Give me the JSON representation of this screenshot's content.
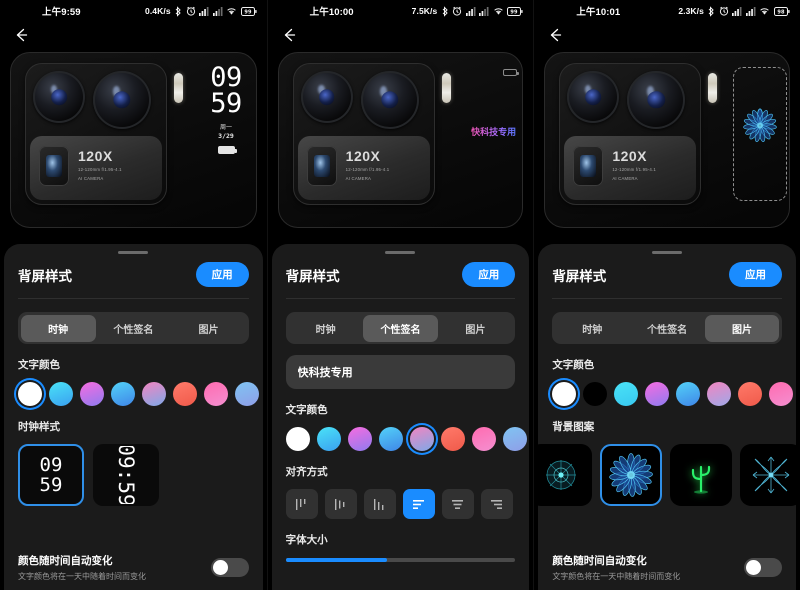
{
  "panels": [
    {
      "statusbar": {
        "time": "上午9:59",
        "netspeed": "0.4K/s",
        "battery": "99"
      },
      "back_label": "back-arrow",
      "preview": {
        "camera": {
          "zoom_label": "120X",
          "spec": "12-120mm f/1.95-4.1",
          "brand": "AI CAMERA"
        },
        "rear_display": {
          "hour": "09",
          "minute": "59",
          "weekday": "周一",
          "date": "3/29"
        }
      },
      "sheet": {
        "title": "背屏样式",
        "apply_label": "应用",
        "tabs": [
          {
            "label": "时钟",
            "active": true
          },
          {
            "label": "个性签名",
            "active": false
          },
          {
            "label": "图片",
            "active": false
          }
        ],
        "text_color_label": "文字颜色",
        "text_colors": [
          {
            "name": "white",
            "css": "#ffffff",
            "selected": true
          },
          {
            "name": "cyan-blue",
            "css": "linear-gradient(160deg,#4ae3f7,#3aa0f0)",
            "selected": false
          },
          {
            "name": "pink-purple",
            "css": "linear-gradient(160deg,#f76ce0,#8f7bf0)",
            "selected": false
          },
          {
            "name": "sky-blue",
            "css": "linear-gradient(160deg,#53d2f8,#3f86e8)",
            "selected": false
          },
          {
            "name": "pink-blue",
            "css": "linear-gradient(160deg,#f285c0,#7fa8e8)",
            "selected": false
          },
          {
            "name": "red-orange",
            "css": "linear-gradient(160deg,#ff7a6a,#f05a4a)",
            "selected": false
          },
          {
            "name": "pink-magenta",
            "css": "linear-gradient(160deg,#ff6bb0,#f48fd0)",
            "selected": false
          },
          {
            "name": "blue-steel",
            "css": "linear-gradient(160deg,#7fc4f2,#8f9ee8)",
            "selected": false
          }
        ],
        "clock_style_label": "时钟样式",
        "clock_styles": [
          {
            "name": "stacked",
            "top": "09",
            "bottom": "59",
            "selected": true
          },
          {
            "name": "rotated",
            "text": "09:59",
            "selected": false
          }
        ],
        "auto_color": {
          "title": "颜色随时间自动变化",
          "subtitle": "文字颜色将在一天中随着时间而变化",
          "enabled": false
        }
      }
    },
    {
      "statusbar": {
        "time": "上午10:00",
        "netspeed": "7.5K/s",
        "battery": "99"
      },
      "back_label": "back-arrow",
      "preview": {
        "camera": {
          "zoom_label": "120X",
          "spec": "12-120mm f/1.95-4.1",
          "brand": "AI CAMERA"
        },
        "rear_display": {
          "signature": "快科技专用"
        }
      },
      "sheet": {
        "title": "背屏样式",
        "apply_label": "应用",
        "tabs": [
          {
            "label": "时钟",
            "active": false
          },
          {
            "label": "个性签名",
            "active": true
          },
          {
            "label": "图片",
            "active": false
          }
        ],
        "signature_value": "快科技专用",
        "signature_placeholder": "快科技专用",
        "text_color_label": "文字颜色",
        "text_colors": [
          {
            "name": "white",
            "css": "#ffffff",
            "selected": false
          },
          {
            "name": "cyan-blue",
            "css": "linear-gradient(160deg,#4ae3f7,#3aa0f0)",
            "selected": false
          },
          {
            "name": "pink-purple",
            "css": "linear-gradient(160deg,#f76ce0,#8f7bf0)",
            "selected": false
          },
          {
            "name": "sky-blue",
            "css": "linear-gradient(160deg,#53d2f8,#3f86e8)",
            "selected": false
          },
          {
            "name": "pink-blue",
            "css": "linear-gradient(160deg,#f285c0,#7fa8e8)",
            "selected": true
          },
          {
            "name": "red-orange",
            "css": "linear-gradient(160deg,#ff7a6a,#f05a4a)",
            "selected": false
          },
          {
            "name": "pink-magenta",
            "css": "linear-gradient(160deg,#ff6bb0,#f48fd0)",
            "selected": false
          },
          {
            "name": "blue-steel",
            "css": "linear-gradient(160deg,#7fc4f2,#8f9ee8)",
            "selected": false
          }
        ],
        "align_label": "对齐方式",
        "aligns": [
          {
            "name": "vertical-top",
            "selected": false
          },
          {
            "name": "vertical-center",
            "selected": false
          },
          {
            "name": "vertical-bottom",
            "selected": false
          },
          {
            "name": "horizontal-left",
            "selected": true
          },
          {
            "name": "horizontal-center",
            "selected": false
          },
          {
            "name": "horizontal-right",
            "selected": false
          }
        ],
        "font_size_label": "字体大小"
      }
    },
    {
      "statusbar": {
        "time": "上午10:01",
        "netspeed": "2.3K/s",
        "battery": "98"
      },
      "back_label": "back-arrow",
      "preview": {
        "camera": {
          "zoom_label": "120X",
          "spec": "12-120mm f/1.95-4.1",
          "brand": "AI CAMERA"
        },
        "rear_display": {
          "pattern": "blue-flower"
        }
      },
      "sheet": {
        "title": "背屏样式",
        "apply_label": "应用",
        "tabs": [
          {
            "label": "时钟",
            "active": false
          },
          {
            "label": "个性签名",
            "active": false
          },
          {
            "label": "图片",
            "active": true
          }
        ],
        "text_color_label": "文字颜色",
        "text_colors": [
          {
            "name": "white",
            "css": "#ffffff",
            "selected": true
          },
          {
            "name": "black",
            "css": "#000000",
            "selected": false
          },
          {
            "name": "cyan",
            "css": "linear-gradient(160deg,#4ae3f7,#38c8f0)",
            "selected": false
          },
          {
            "name": "pink-purple",
            "css": "linear-gradient(160deg,#f76ce0,#8f7bf0)",
            "selected": false
          },
          {
            "name": "sky-blue",
            "css": "linear-gradient(160deg,#53d2f8,#3f86e8)",
            "selected": false
          },
          {
            "name": "pink-blue",
            "css": "linear-gradient(160deg,#f285c0,#9fa8e8)",
            "selected": false
          },
          {
            "name": "red-orange",
            "css": "linear-gradient(160deg,#ff7a6a,#f05a4a)",
            "selected": false
          },
          {
            "name": "pink-magenta",
            "css": "linear-gradient(160deg,#ff6bb0,#f48fd0)",
            "selected": false
          }
        ],
        "bg_pattern_label": "背景图案",
        "bg_patterns": [
          {
            "name": "teal-burst",
            "selected": false
          },
          {
            "name": "blue-flower",
            "selected": true
          },
          {
            "name": "green-cactus",
            "selected": false
          },
          {
            "name": "blue-snowflake",
            "selected": false
          }
        ],
        "auto_color": {
          "title": "颜色随时间自动变化",
          "subtitle": "文字颜色将在一天中随着时间而变化",
          "enabled": false
        }
      }
    }
  ]
}
